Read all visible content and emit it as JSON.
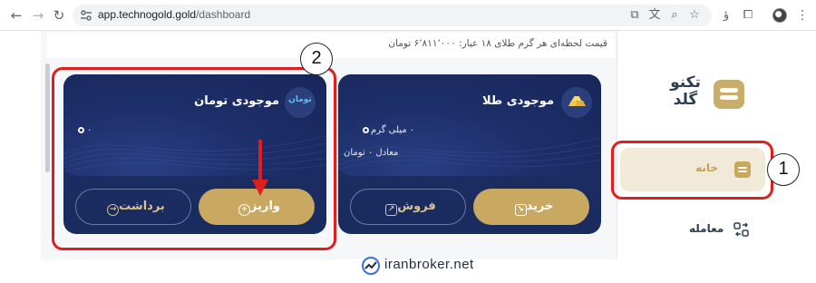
{
  "browser": {
    "url_domain": "app.technogold.gold",
    "url_path": "/dashboard",
    "icons": [
      "back-arrow-icon",
      "forward-arrow-icon",
      "reload-icon",
      "site-settings-icon",
      "install-app-icon",
      "translate-icon",
      "zoom-icon",
      "bookmark-star-icon",
      "extension-icon",
      "extensions-puzzle-icon",
      "profile-avatar-icon",
      "menu-kebab-icon"
    ]
  },
  "header": {
    "price_text": "قیمت لحظه‌ای هر گرم طلای ۱۸ عیار: ۶٬۸۱۱٬۰۰۰ تومان"
  },
  "sidebar": {
    "logo_text": "تکنو گلد",
    "items": [
      {
        "label": "خانه",
        "icon": "home-wallet-icon",
        "active": true
      },
      {
        "label": "معامله",
        "icon": "trade-icon",
        "active": false
      }
    ]
  },
  "gold_card": {
    "title": "موجودی طلا",
    "icon": "gold-bars-icon",
    "line1": "۰ میلی گرم",
    "line2": "معادل ۰ تومان",
    "buy_label": "خرید",
    "sell_label": "فروش"
  },
  "toman_card": {
    "title": "موجودی تومان",
    "icon": "toman-icon",
    "icon_text": "تومان",
    "balance": "۰",
    "deposit_label": "واریز",
    "withdraw_label": "برداشت"
  },
  "annotations": {
    "label_1": "1",
    "label_2": "2",
    "color": "#e01e1e"
  },
  "watermark": {
    "text": "iranbroker.net"
  },
  "colors": {
    "gold": "#c9a962",
    "navy": "#1c2d63",
    "home_bg": "#f1ead8"
  }
}
